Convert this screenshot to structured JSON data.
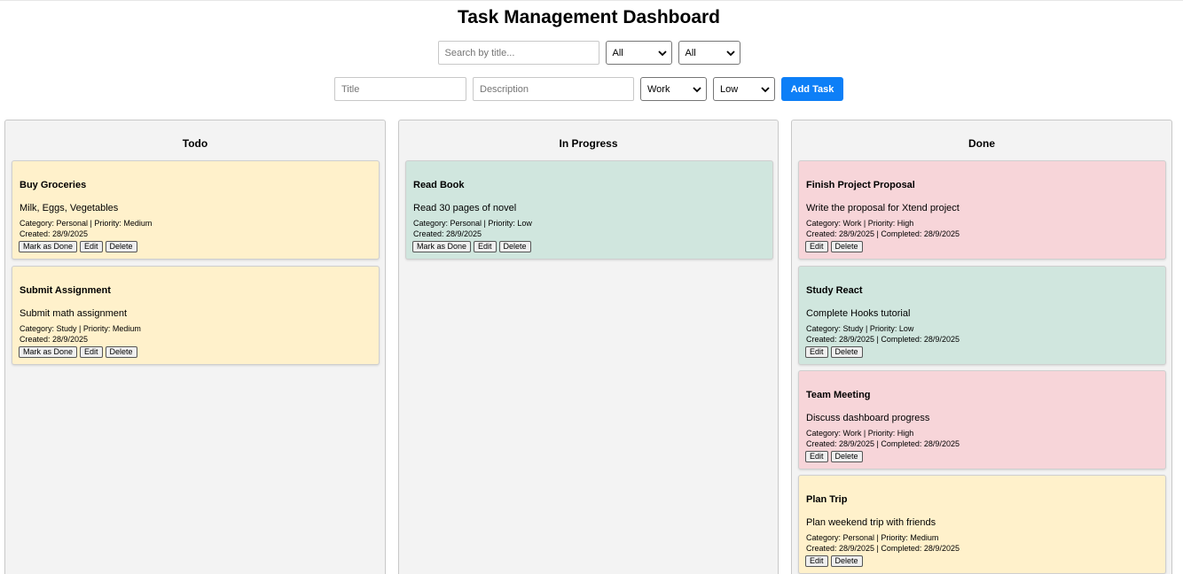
{
  "title": "Task Management Dashboard",
  "filters": {
    "search_placeholder": "Search by title...",
    "category_value": "All",
    "priority_value": "All"
  },
  "new_task": {
    "title_placeholder": "Title",
    "description_placeholder": "Description",
    "category_value": "Work",
    "priority_value": "Low",
    "add_label": "Add Task"
  },
  "columns": [
    {
      "name": "Todo",
      "cards": [
        {
          "title": "Buy Groceries",
          "description": "Milk, Eggs, Vegetables",
          "meta": "Category: Personal | Priority: Medium",
          "dates": "Created: 28/9/2025",
          "actions": [
            "Mark as Done",
            "Edit",
            "Delete"
          ]
        },
        {
          "title": "Submit Assignment",
          "description": "Submit math assignment",
          "meta": "Category: Study | Priority: Medium",
          "dates": "Created: 28/9/2025",
          "actions": [
            "Mark as Done",
            "Edit",
            "Delete"
          ]
        }
      ]
    },
    {
      "name": "In Progress",
      "cards": [
        {
          "title": "Read Book",
          "description": "Read 30 pages of novel",
          "meta": "Category: Personal | Priority: Low",
          "dates": "Created: 28/9/2025",
          "actions": [
            "Mark as Done",
            "Edit",
            "Delete"
          ]
        }
      ]
    },
    {
      "name": "Done",
      "cards": [
        {
          "title": "Finish Project Proposal",
          "description": "Write the proposal for Xtend project",
          "meta": "Category: Work | Priority: High",
          "dates": "Created: 28/9/2025 | Completed: 28/9/2025",
          "actions": [
            "Edit",
            "Delete"
          ]
        },
        {
          "title": "Study React",
          "description": "Complete Hooks tutorial",
          "meta": "Category: Study | Priority: Low",
          "dates": "Created: 28/9/2025 | Completed: 28/9/2025",
          "actions": [
            "Edit",
            "Delete"
          ]
        },
        {
          "title": "Team Meeting",
          "description": "Discuss dashboard progress",
          "meta": "Category: Work | Priority: High",
          "dates": "Created: 28/9/2025 | Completed: 28/9/2025",
          "actions": [
            "Edit",
            "Delete"
          ]
        },
        {
          "title": "Plan Trip",
          "description": "Plan weekend trip with friends",
          "meta": "Category: Personal | Priority: Medium",
          "dates": "Created: 28/9/2025 | Completed: 28/9/2025",
          "actions": [
            "Edit",
            "Delete"
          ]
        }
      ]
    }
  ],
  "colors": {
    "priority_medium": "#fff1cb",
    "priority_low": "#d0e6de",
    "priority_high": "#f7d5d9",
    "accent": "#0d7ff7",
    "column_bg": "#f3f3f3"
  }
}
